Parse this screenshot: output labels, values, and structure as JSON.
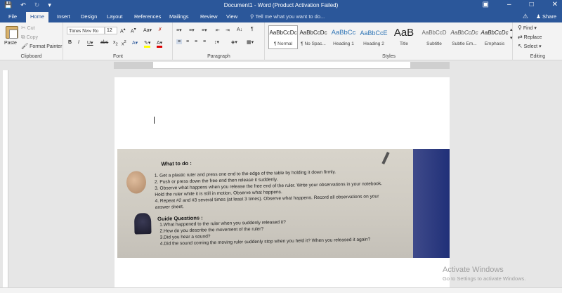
{
  "window": {
    "title": "Document1 - Word (Product Activation Failed)"
  },
  "tabs": [
    "File",
    "Home",
    "Insert",
    "Design",
    "Layout",
    "References",
    "Mailings",
    "Review",
    "View"
  ],
  "tell_me": "Tell me what you want to do...",
  "share": "Share",
  "clipboard": {
    "paste": "Paste",
    "cut": "Cut",
    "copy": "Copy",
    "format_painter": "Format Painter",
    "label": "Clipboard"
  },
  "font": {
    "name": "Times New Ro",
    "size": "12",
    "label": "Font"
  },
  "paragraph": {
    "label": "Paragraph"
  },
  "styles": {
    "label": "Styles",
    "items": [
      {
        "sample": "AaBbCcDc",
        "name": "¶ Normal"
      },
      {
        "sample": "AaBbCcDc",
        "name": "¶ No Spac..."
      },
      {
        "sample": "AaBbCc",
        "name": "Heading 1"
      },
      {
        "sample": "AaBbCcE",
        "name": "Heading 2"
      },
      {
        "sample": "AaB",
        "name": "Title"
      },
      {
        "sample": "AaBbCcD",
        "name": "Subtitle"
      },
      {
        "sample": "AaBbCcDc",
        "name": "Subtle Em..."
      },
      {
        "sample": "AaBbCcDc",
        "name": "Emphasis"
      }
    ]
  },
  "editing": {
    "find": "Find",
    "replace": "Replace",
    "select": "Select",
    "label": "Editing"
  },
  "photo": {
    "heading": "What to do :",
    "steps": [
      "1.   Get a plastic ruler and press one end to the edge of the table by holding it down firmly.",
      "2.   Push or press down the free end then release it suddenly.",
      "3.   Observe what happens when you release the free end of the ruler.  Write your observations in your notebook.",
      "      Hold the ruler while it is still in motion.  Observe what happens.",
      "4.   Repeat #2 and #3 several times (at least 3 times).  Observe what happens.  Record all observations on your",
      "      answer sheet."
    ],
    "guide_heading": "Guide Questions :",
    "questions": [
      "1.What happened to the ruler when you suddenly released it?",
      "2.How do you describe the movement of the ruler?",
      "3.Did you hear a sound?",
      "4.Did the sound coming the moving ruler suddenly stop when you held it? When you released it again?"
    ]
  },
  "watermark": {
    "line1": "Activate Windows",
    "line2": "Go to Settings to activate Windows."
  }
}
